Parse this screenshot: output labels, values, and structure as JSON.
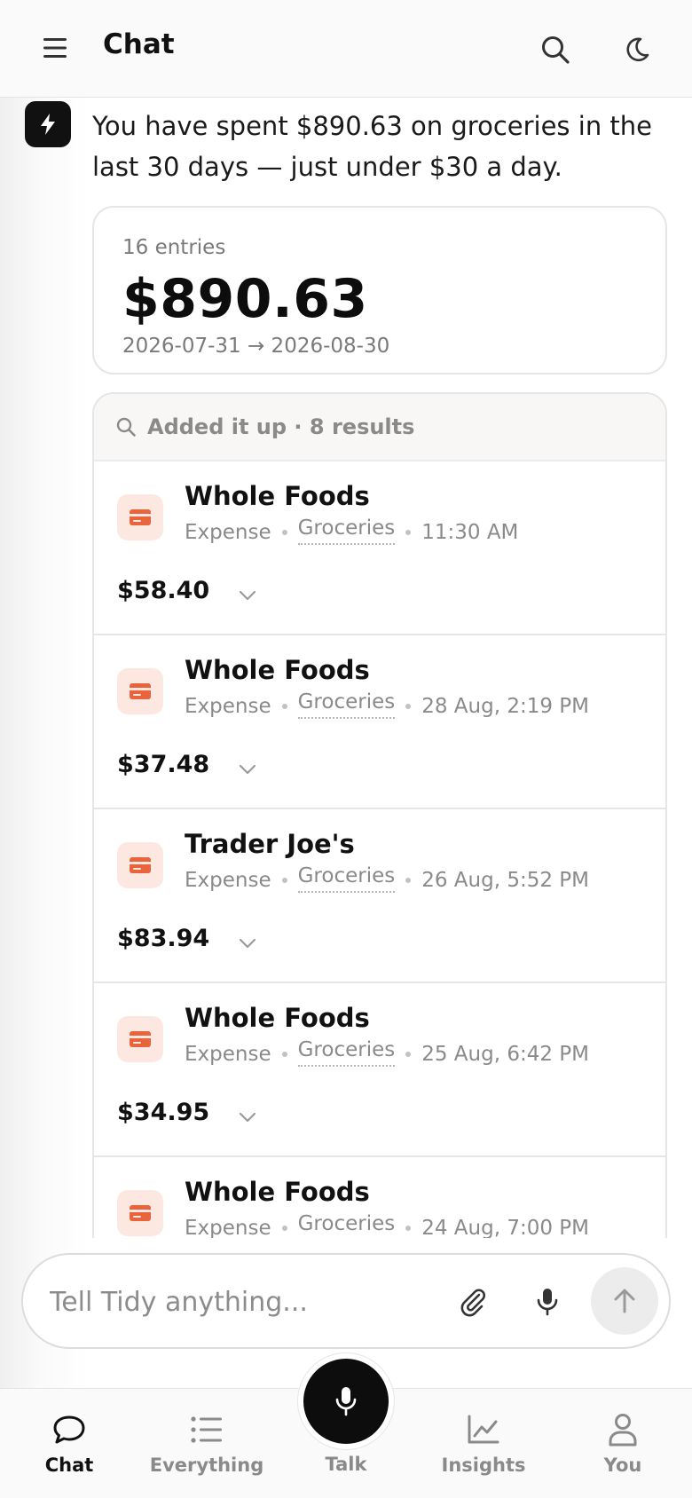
{
  "header": {
    "title": "Chat",
    "menu_icon": "hamburger-menu-icon",
    "search_icon": "search-icon",
    "theme_icon": "moon-icon"
  },
  "assistant": {
    "avatar_icon": "lightning-bolt-icon",
    "message": "You have spent $890.63 on groceries in the last 30 days — just under $30 a day."
  },
  "summary": {
    "entries": "16 entries",
    "total": "$890.63",
    "range": "2026-07-31 → 2026-08-30"
  },
  "results": {
    "label": "Added it up · 8 results",
    "icon": "search-icon",
    "items": [
      {
        "name": "Whole Foods",
        "type": "Expense",
        "category": "Groceries",
        "time": "11:30 AM",
        "amount": "$58.40"
      },
      {
        "name": "Whole Foods",
        "type": "Expense",
        "category": "Groceries",
        "time": "28 Aug, 2:19 PM",
        "amount": "$37.48"
      },
      {
        "name": "Trader Joe's",
        "type": "Expense",
        "category": "Groceries",
        "time": "26 Aug, 5:52 PM",
        "amount": "$83.94"
      },
      {
        "name": "Whole Foods",
        "type": "Expense",
        "category": "Groceries",
        "time": "25 Aug, 6:42 PM",
        "amount": "$34.95"
      },
      {
        "name": "Whole Foods",
        "type": "Expense",
        "category": "Groceries",
        "time": "24 Aug, 7:00 PM",
        "amount": ""
      }
    ]
  },
  "composer": {
    "placeholder": "Tell Tidy anything...",
    "attach_icon": "paperclip-icon",
    "mic_icon": "microphone-icon",
    "send_icon": "arrow-up-icon"
  },
  "nav": {
    "chat": "Chat",
    "everything": "Everything",
    "talk": "Talk",
    "insights": "Insights",
    "you": "You"
  },
  "colors": {
    "accent": "#e8643c",
    "accent_bg": "#fde8e1",
    "dark": "#0d0d0d"
  }
}
